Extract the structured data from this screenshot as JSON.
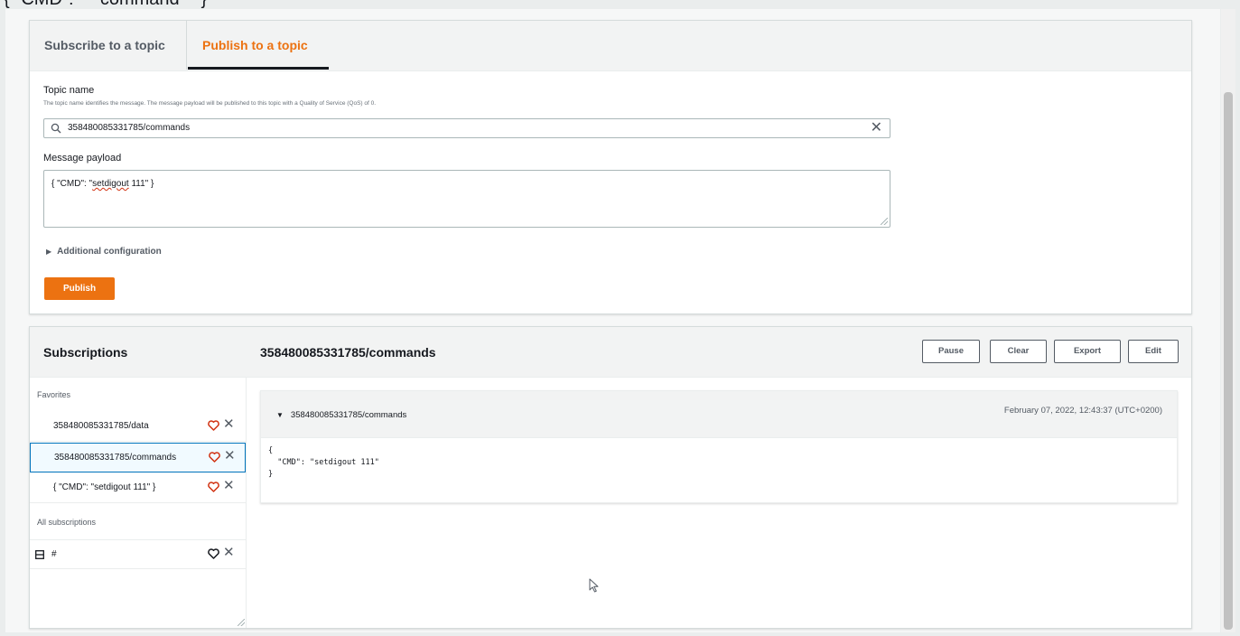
{
  "overlay": {
    "cut_text": "{ \"CMD\":  \"  command  \" }"
  },
  "publish": {
    "tabs": [
      {
        "label": "Subscribe to a topic",
        "active": false
      },
      {
        "label": "Publish to a topic",
        "active": true
      }
    ],
    "topic_label": "Topic name",
    "topic_description": "The topic name identifies the message. The message payload will be published to this topic with a Quality of Service (QoS) of 0.",
    "topic_value": "358480085331785/commands",
    "payload_label": "Message payload",
    "payload_pre": "{ \"CMD\": \"",
    "payload_underlined": "setdigout",
    "payload_post": " 111\" }",
    "additional_config": "Additional configuration",
    "publish_button": "Publish"
  },
  "subscriptions": {
    "title": "Subscriptions",
    "topic_title": "358480085331785/commands",
    "buttons": {
      "pause": "Pause",
      "clear": "Clear",
      "export": "Export",
      "edit": "Edit"
    },
    "favorites_label": "Favorites",
    "favorites": [
      {
        "name": "358480085331785/data",
        "selected": false,
        "heart": "empty"
      },
      {
        "name": "358480085331785/commands",
        "selected": true,
        "heart": "empty"
      },
      {
        "name": "{ \"CMD\": \"setdigout 111\" }",
        "selected": false,
        "heart": "empty"
      }
    ],
    "all_label": "All subscriptions",
    "all": [
      {
        "name": "#",
        "icon": "list-icon"
      }
    ]
  },
  "message": {
    "topic": "358480085331785/commands",
    "timestamp": "February 07, 2022, 12:43:37 (UTC+0200)",
    "body": "{\n  \"CMD\": \"setdigout 111\"\n}"
  },
  "colors": {
    "accent": "#ec7211",
    "selection": "#0073bb",
    "heart": "#d13212"
  }
}
